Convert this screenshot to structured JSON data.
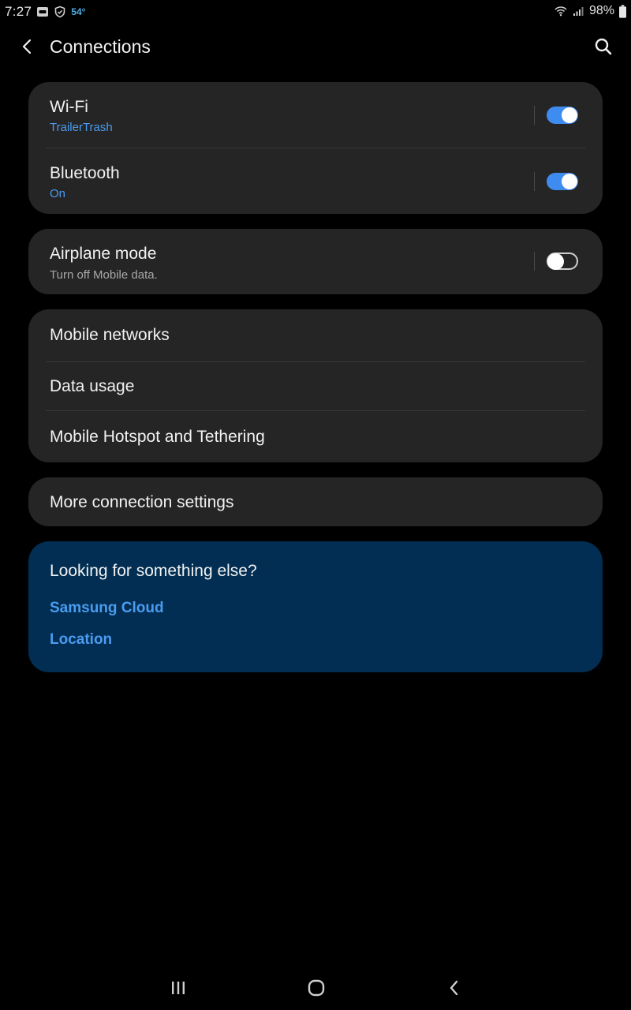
{
  "status_bar": {
    "time": "7:27",
    "temperature": "54°",
    "battery": "98%"
  },
  "header": {
    "title": "Connections"
  },
  "cards": {
    "wifi": {
      "title": "Wi-Fi",
      "subtitle": "TrailerTrash",
      "enabled": true
    },
    "bluetooth": {
      "title": "Bluetooth",
      "subtitle": "On",
      "enabled": true
    },
    "airplane": {
      "title": "Airplane mode",
      "subtitle": "Turn off Mobile data.",
      "enabled": false
    },
    "mobile_networks": {
      "title": "Mobile networks"
    },
    "data_usage": {
      "title": "Data usage"
    },
    "hotspot": {
      "title": "Mobile Hotspot and Tethering"
    },
    "more": {
      "title": "More connection settings"
    }
  },
  "suggestions": {
    "title": "Looking for something else?",
    "links": [
      "Samsung Cloud",
      "Location"
    ]
  },
  "colors": {
    "accent": "#3e8cf0",
    "link": "#4b9bf0",
    "card_bg": "#252525",
    "suggest_bg": "#012e52"
  },
  "icons": {
    "back": "chevron-left-icon",
    "search": "search-icon",
    "nav_recents": "recents-icon",
    "nav_home": "home-icon",
    "nav_back": "nav-back-icon"
  }
}
